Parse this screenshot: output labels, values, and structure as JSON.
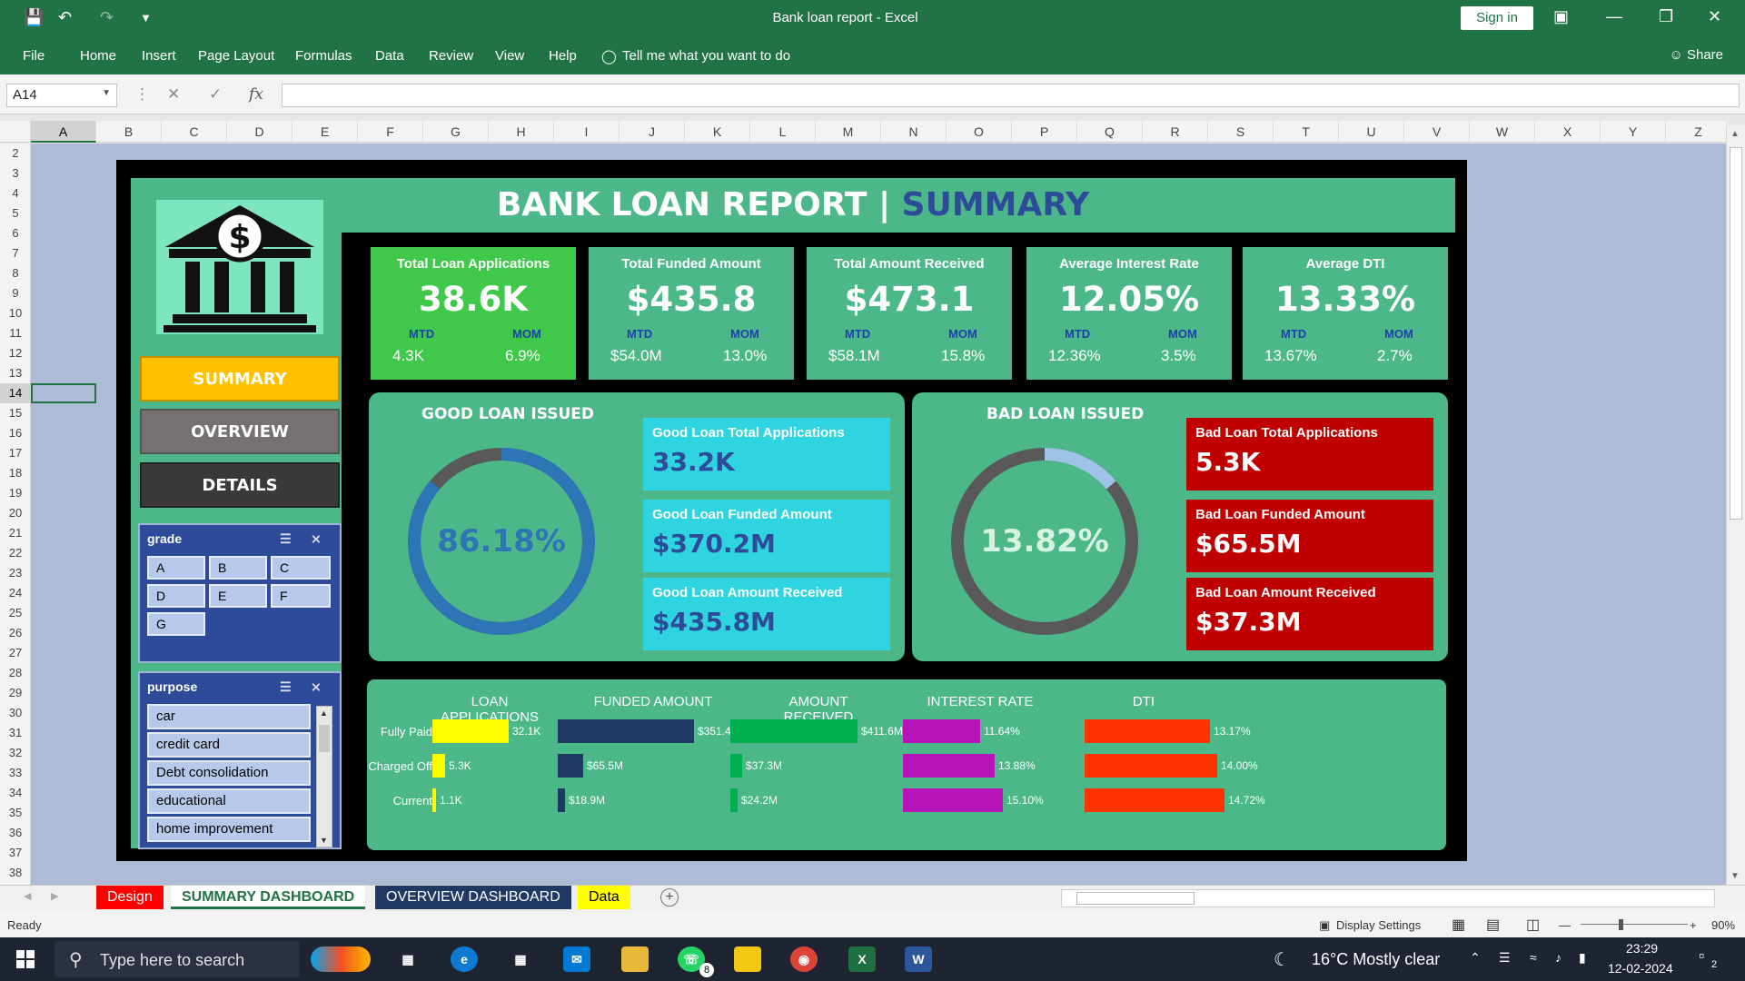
{
  "window": {
    "title": "Bank loan report  -  Excel",
    "sign_in": "Sign in",
    "share": "Share"
  },
  "ribbon": {
    "tabs": [
      "File",
      "Home",
      "Insert",
      "Page Layout",
      "Formulas",
      "Data",
      "Review",
      "View",
      "Help"
    ],
    "tell_me": "Tell me what you want to do"
  },
  "formula_bar": {
    "name_box": "A14",
    "fx": "fx",
    "value": ""
  },
  "grid": {
    "columns": [
      "A",
      "B",
      "C",
      "D",
      "E",
      "F",
      "G",
      "H",
      "I",
      "J",
      "K",
      "L",
      "M",
      "N",
      "O",
      "P",
      "Q",
      "R",
      "S",
      "T",
      "U",
      "V",
      "W",
      "X",
      "Y",
      "Z"
    ],
    "rows": [
      "2",
      "3",
      "4",
      "5",
      "6",
      "7",
      "8",
      "9",
      "10",
      "11",
      "12",
      "13",
      "14",
      "15",
      "16",
      "17",
      "18",
      "19",
      "20",
      "21",
      "22",
      "23",
      "24",
      "25",
      "26",
      "27",
      "28",
      "29",
      "30",
      "31",
      "32",
      "33",
      "34",
      "35",
      "36",
      "37",
      "38"
    ],
    "selected_column": "A",
    "selected_row": "14"
  },
  "dashboard": {
    "title_main": "BANK LOAN REPORT",
    "title_sep": " | ",
    "title_accent": "SUMMARY",
    "nav": {
      "summary": "SUMMARY",
      "overview": "OVERVIEW",
      "details": "DETAILS"
    },
    "slicers": {
      "grade": {
        "title": "grade",
        "items": [
          "A",
          "B",
          "C",
          "D",
          "E",
          "F",
          "G"
        ]
      },
      "purpose": {
        "title": "purpose",
        "items": [
          "car",
          "credit card",
          "Debt consolidation",
          "educational",
          "home improvement"
        ]
      }
    },
    "kpis": [
      {
        "title": "Total Loan Applications",
        "value": "38.6K",
        "mtd_label": "MTD",
        "mom_label": "MOM",
        "mtd": "4.3K",
        "mom": "6.9%"
      },
      {
        "title": "Total Funded Amount",
        "value": "$435.8",
        "mtd_label": "MTD",
        "mom_label": "MOM",
        "mtd": "$54.0M",
        "mom": "13.0%"
      },
      {
        "title": "Total Amount Received",
        "value": "$473.1",
        "mtd_label": "MTD",
        "mom_label": "MOM",
        "mtd": "$58.1M",
        "mom": "15.8%"
      },
      {
        "title": "Average Interest Rate",
        "value": "12.05%",
        "mtd_label": "MTD",
        "mom_label": "MOM",
        "mtd": "12.36%",
        "mom": "3.5%"
      },
      {
        "title": "Average DTI",
        "value": "13.33%",
        "mtd_label": "MTD",
        "mom_label": "MOM",
        "mtd": "13.67%",
        "mom": "2.7%"
      }
    ],
    "good_loan": {
      "title": "GOOD LOAN ISSUED",
      "percent": "86.18%",
      "fraction": 0.8618,
      "cards": [
        {
          "title": "Good Loan Total Applications",
          "value": "33.2K"
        },
        {
          "title": "Good Loan Funded Amount",
          "value": "$370.2M"
        },
        {
          "title": "Good Loan Amount Received",
          "value": "$435.8M"
        }
      ]
    },
    "bad_loan": {
      "title": "BAD LOAN ISSUED",
      "percent": "13.82%",
      "fraction": 0.1382,
      "cards": [
        {
          "title": "Bad Loan Total Applications",
          "value": "5.3K"
        },
        {
          "title": "Bad Loan Funded Amount",
          "value": "$65.5M"
        },
        {
          "title": "Bad Loan Amount Received",
          "value": "$37.3M"
        }
      ]
    },
    "colors": {
      "panel": "#4cb88a",
      "kpi_highlight": "#3fc84a",
      "good_card": "#2ed4df",
      "bad_card": "#c00000",
      "good_ring": "#2e75b6",
      "bad_ring": "#9dc3e6",
      "ring_track": "#595959"
    }
  },
  "chart_data": {
    "type": "bar",
    "categories": [
      "Fully Paid",
      "Charged Off",
      "Current"
    ],
    "series": [
      {
        "name": "LOAN APPLICATIONS",
        "values": [
          32.1,
          5.3,
          1.1
        ],
        "labels": [
          "32.1K",
          "5.3K",
          "1.1K"
        ],
        "color": "#ffff00"
      },
      {
        "name": "FUNDED AMOUNT",
        "values": [
          351.4,
          65.5,
          18.9
        ],
        "labels": [
          "$351.4M",
          "$65.5M",
          "$18.9M"
        ],
        "color": "#203864"
      },
      {
        "name": "AMOUNT RECEIVED",
        "values": [
          411.6,
          37.3,
          24.2
        ],
        "labels": [
          "$411.6M",
          "$37.3M",
          "$24.2M"
        ],
        "color": "#00b050"
      },
      {
        "name": "INTEREST RATE",
        "values": [
          11.64,
          13.88,
          15.1
        ],
        "labels": [
          "11.64%",
          "13.88%",
          "15.10%"
        ],
        "color": "#b614b6"
      },
      {
        "name": "DTI",
        "values": [
          13.17,
          14.0,
          14.72
        ],
        "labels": [
          "13.17%",
          "14.00%",
          "14.72%"
        ],
        "color": "#ff3300"
      }
    ]
  },
  "sheet_tabs": [
    "Design",
    "SUMMARY DASHBOARD",
    "OVERVIEW DASHBOARD",
    "Data"
  ],
  "status_bar": {
    "ready": "Ready",
    "display_settings": "Display Settings",
    "zoom": "90%"
  },
  "taskbar": {
    "search_placeholder": "Type here to search",
    "weather": "16°C  Mostly clear",
    "time": "23:29",
    "date": "12-02-2024",
    "whatsapp_badge": "8",
    "notifications": "2"
  }
}
